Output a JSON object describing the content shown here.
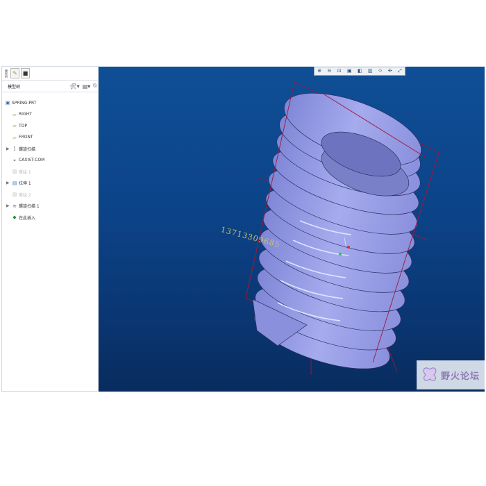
{
  "left_panel": {
    "vertical_tab_label": "模型树",
    "header_title": "模型树",
    "tree": [
      {
        "label": "SPRING.PRT",
        "icon": "part-icon",
        "dim": false,
        "expand": false
      },
      {
        "label": "RIGHT",
        "icon": "datum-plane-icon",
        "dim": false,
        "expand": false
      },
      {
        "label": "TOP",
        "icon": "datum-plane-icon",
        "dim": false,
        "expand": false
      },
      {
        "label": "FRONT",
        "icon": "datum-plane-icon",
        "dim": false,
        "expand": false
      },
      {
        "label": "螺旋扫描",
        "icon": "helical-sweep-icon",
        "dim": false,
        "expand": true
      },
      {
        "label": "CAXIST-COM",
        "icon": "coordinate-system-icon",
        "dim": false,
        "expand": false
      },
      {
        "label": "草绘 1",
        "icon": "sketch-icon",
        "dim": true,
        "expand": false
      },
      {
        "label": "拉伸 1",
        "icon": "extrude-icon",
        "dim": false,
        "expand": true
      },
      {
        "label": "草绘 2",
        "icon": "sketch-icon",
        "dim": true,
        "expand": false
      },
      {
        "label": "螺旋扫描 1",
        "icon": "helical-sweep-icon",
        "dim": false,
        "expand": true
      },
      {
        "label": "在此插入",
        "icon": "insert-here-icon",
        "dim": false,
        "expand": false
      }
    ]
  },
  "viewport": {
    "toolbar_icons": [
      "zoom-in-icon",
      "zoom-out-icon",
      "refit-icon",
      "repaint-icon",
      "display-style-icon",
      "saved-views-icon",
      "datum-display-icon",
      "spin-center-icon",
      "annotation-icon"
    ],
    "watermark_text": "13713309685",
    "logo_text": "野火论坛",
    "colors": {
      "background_top": "#0f4f96",
      "background_bottom": "#082c5e",
      "spring_fill": "#9aa0e8",
      "datum_lines": "#9a1a3a"
    }
  }
}
